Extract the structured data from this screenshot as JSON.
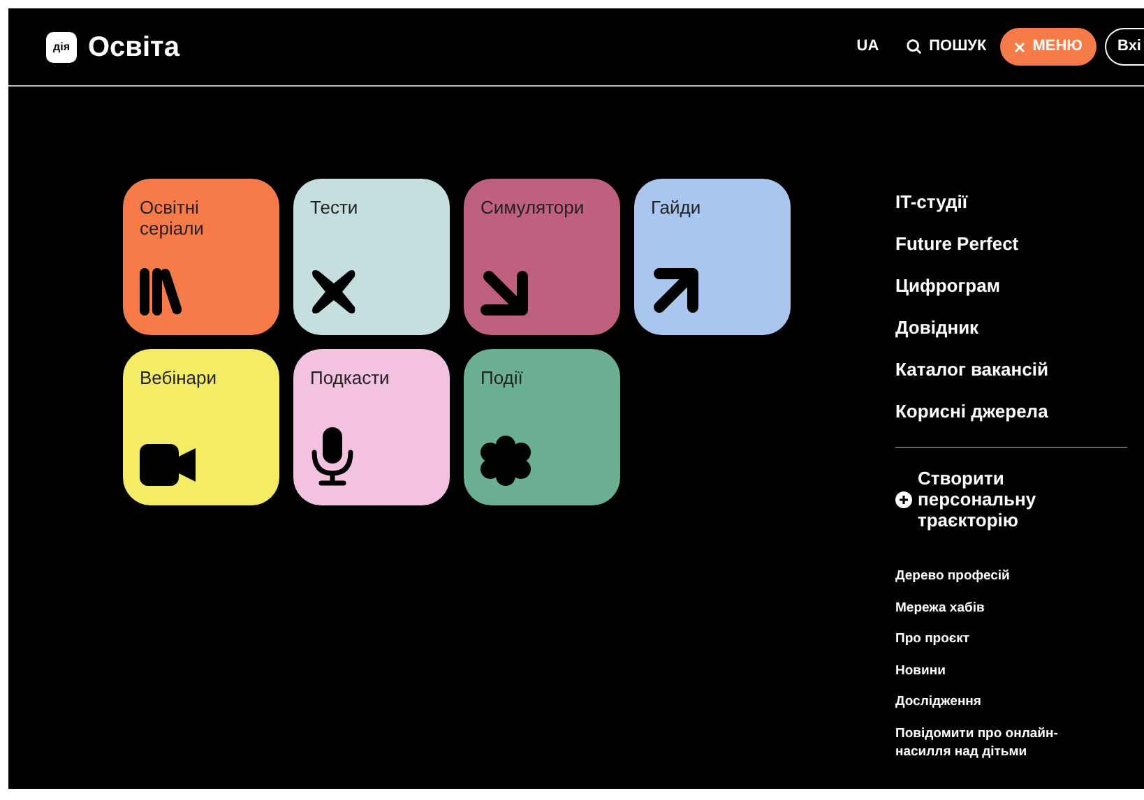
{
  "header": {
    "logo_badge": "дія",
    "logo_text": "Освіта",
    "language": {
      "label": "UA",
      "selected": true
    },
    "search": "ПОШУК",
    "menu_button": "МЕНЮ",
    "login_button": "Вхі"
  },
  "tiles": [
    {
      "label": "Освітні серіали",
      "color": "#f77b48",
      "kind": "books"
    },
    {
      "label": "Тести",
      "color": "#c5dfdf",
      "kind": "cross"
    },
    {
      "label": "Симулятори",
      "color": "#c0607f",
      "kind": "arrow-down-right"
    },
    {
      "label": "Гайди",
      "color": "#a8c6ee",
      "kind": "arrow-up-right"
    },
    {
      "label": "Вебінари",
      "color": "#f5ec66",
      "kind": "camera"
    },
    {
      "label": "Подкасти",
      "color": "#f3c2e0",
      "kind": "mic"
    },
    {
      "label": "Події",
      "color": "#6bb092",
      "kind": "flower"
    }
  ],
  "main_links": [
    "IT-студії",
    "Future Perfect",
    "Цифрограм",
    "Довідник",
    "Каталог вакансій",
    "Корисні джерела"
  ],
  "create_trajectory": "Створити персональну траєкторію",
  "secondary_links": [
    "Дерево професій",
    "Мережа хабів",
    "Про проєкт",
    "Новини",
    "Дослідження",
    "Повідомити про онлайн-насилля над дітьми"
  ]
}
